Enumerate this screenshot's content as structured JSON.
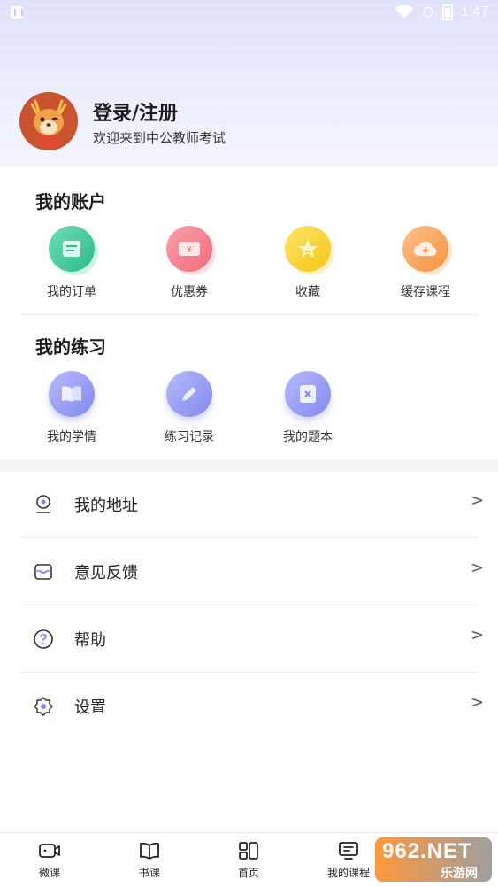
{
  "status_bar": {
    "time": "1:47"
  },
  "profile": {
    "title": "登录/注册",
    "subtitle": "欢迎来到中公教师考试"
  },
  "account": {
    "title": "我的账户",
    "items": [
      {
        "label": "我的订单",
        "icon": "order-icon",
        "color": "#3ec79a"
      },
      {
        "label": "优惠券",
        "icon": "coupon-icon",
        "color": "#f47a86"
      },
      {
        "label": "收藏",
        "icon": "star-icon",
        "color": "#f7cf2a"
      },
      {
        "label": "缓存课程",
        "icon": "download-cloud-icon",
        "color": "#f9a35a"
      }
    ]
  },
  "practice": {
    "title": "我的练习",
    "items": [
      {
        "label": "我的学情",
        "icon": "book-icon",
        "color": "#8f97f3"
      },
      {
        "label": "练习记录",
        "icon": "pencil-icon",
        "color": "#8f97f3"
      },
      {
        "label": "我的题本",
        "icon": "question-book-icon",
        "color": "#8f97f3"
      }
    ]
  },
  "menu": [
    {
      "label": "我的地址",
      "icon": "location-icon",
      "chevron": ">"
    },
    {
      "label": "意见反馈",
      "icon": "feedback-icon",
      "chevron": ">"
    },
    {
      "label": "帮助",
      "icon": "help-icon",
      "chevron": ">"
    },
    {
      "label": "设置",
      "icon": "settings-icon",
      "chevron": ">"
    }
  ],
  "bottom_nav": [
    {
      "label": "微课",
      "icon": "video-icon"
    },
    {
      "label": "书课",
      "icon": "book-course-icon"
    },
    {
      "label": "首页",
      "icon": "home-icon"
    },
    {
      "label": "我的课程",
      "icon": "my-course-icon"
    }
  ],
  "watermark": {
    "top": "962.NET",
    "bottom": "乐游网"
  }
}
